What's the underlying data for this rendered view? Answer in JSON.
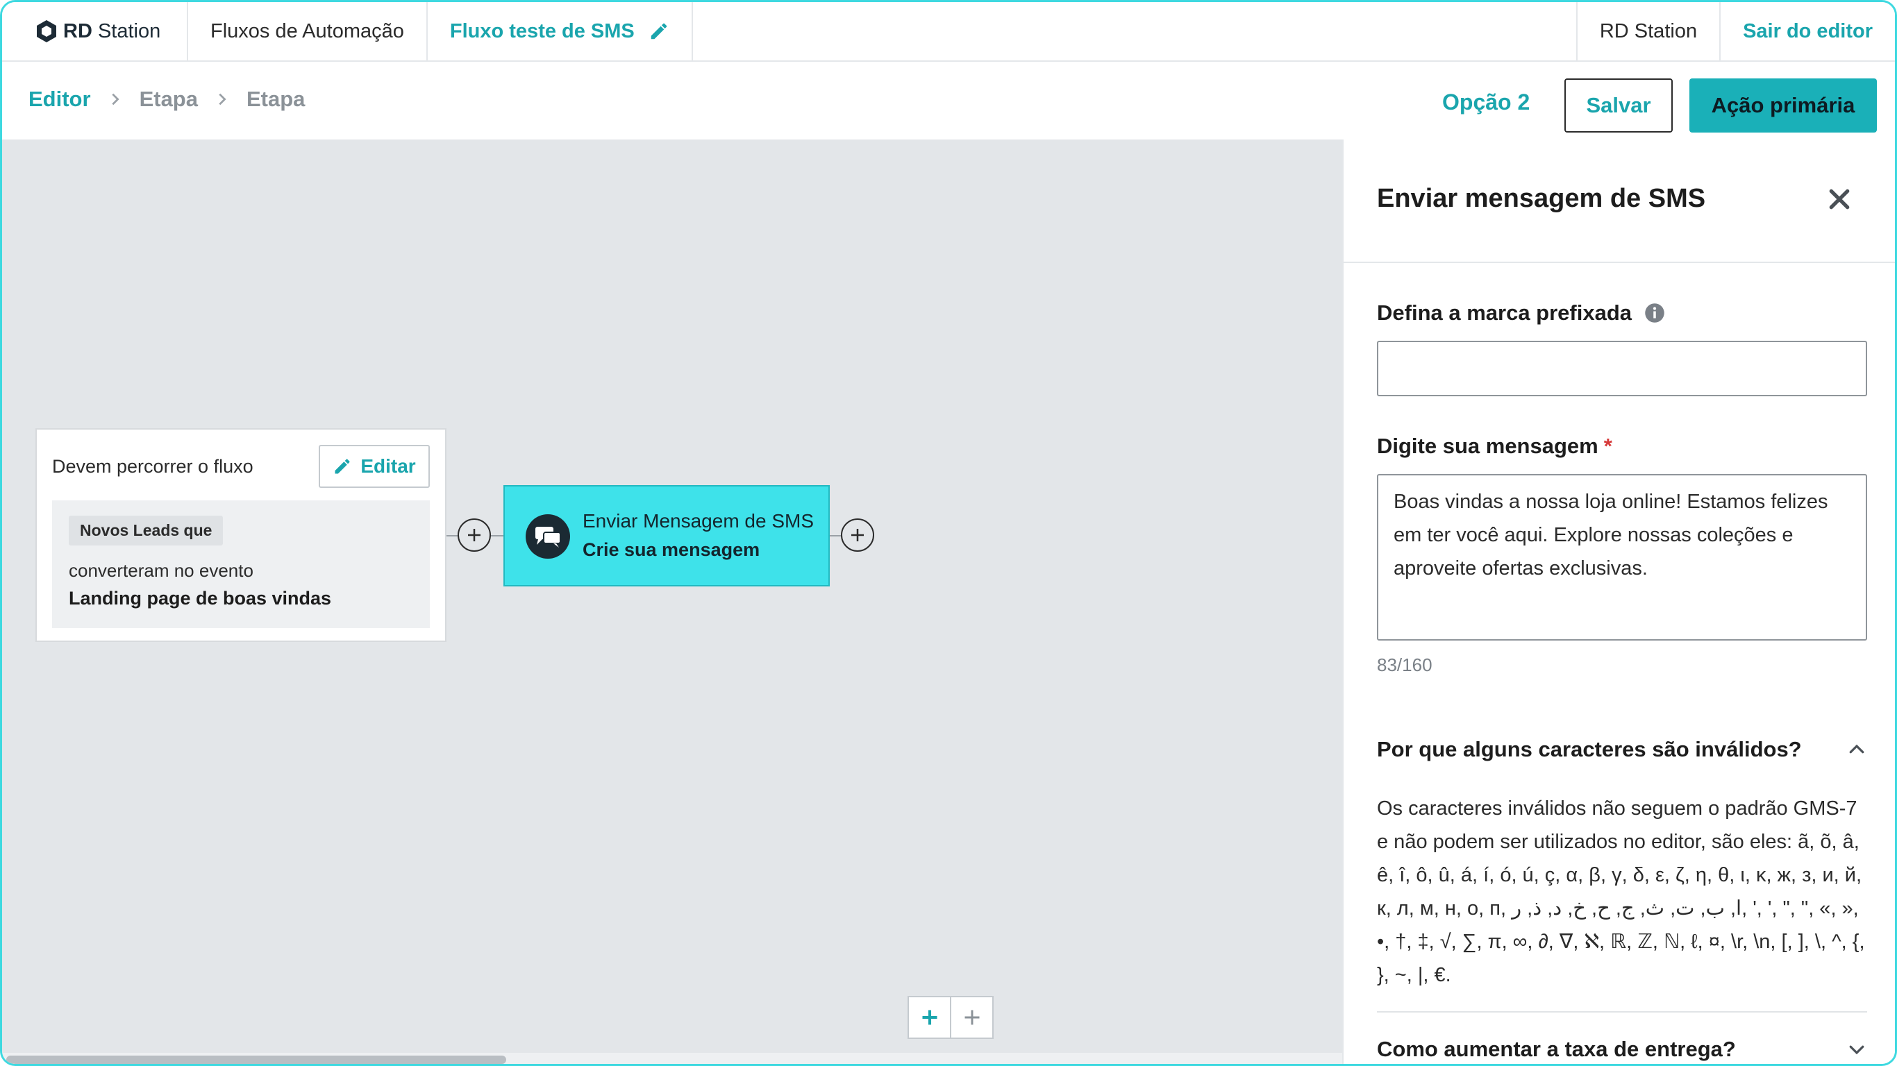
{
  "topbar": {
    "logo_bold": "RD",
    "logo_regular": "Station",
    "nav_flows": "Fluxos de Automação",
    "flow_name": "Fluxo teste de SMS",
    "rd_station": "RD Station",
    "exit_editor": "Sair do editor"
  },
  "breadcrumb": {
    "items": [
      "Editor",
      "Etapa",
      "Etapa"
    ]
  },
  "actions": {
    "option2": "Opção 2",
    "save": "Salvar",
    "primary": "Ação primária"
  },
  "canvas": {
    "trigger": {
      "title": "Devem percorrer o fluxo",
      "edit_label": "Editar",
      "tag": "Novos Leads que",
      "condition": "converteram no evento",
      "event": "Landing page de boas vindas"
    },
    "sms_node": {
      "title": "Enviar Mensagem de SMS",
      "subtitle": "Crie sua mensagem"
    }
  },
  "panel": {
    "title": "Enviar mensagem de SMS",
    "brand_label": "Defina a marca prefixada",
    "brand_value": "",
    "message_label": "Digite sua mensagem",
    "required_mark": "*",
    "message_value": "Boas vindas a nossa loja online! Estamos felizes em ter você aqui. Explore nossas coleções e aproveite ofertas exclusivas.",
    "counter": "83/160",
    "accordion1_title": "Por que alguns caracteres são inválidos?",
    "accordion1_body": "Os caracteres inválidos não seguem o padrão GMS-7 e não podem ser utilizados no editor, são eles: ã, õ, â, ê, î, ô, û, á, í, ó, ú, ç, α, β, γ, δ, ε, ζ, η, θ, ι, κ, ж, з, и, й, к, л, м, н, о, п, ا, ب, ت, ث, ج, ح, خ, د, ذ, ر, ', ', \", \", «, », •, †, ‡, √, ∑, π, ∞, ∂, ∇, ℵ, ℝ, ℤ, ℕ, ℓ, ¤, \\r, \\n, [, ], \\, ^, {, }, ~, |, €.",
    "accordion2_title": "Como aumentar a taxa de entrega?"
  },
  "colors": {
    "accent": "#1aa5ad",
    "node": "#3ee2ea",
    "primary_button": "#1ab0b8",
    "canvas_bg": "#e3e6e9"
  }
}
